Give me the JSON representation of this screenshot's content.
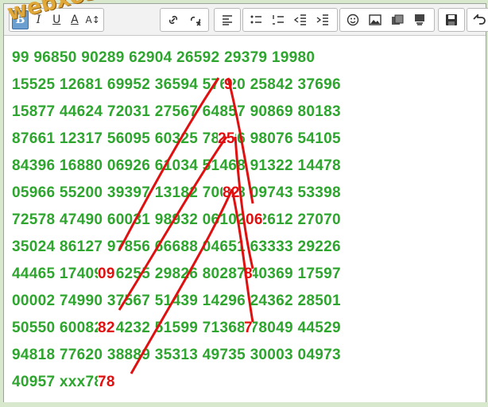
{
  "toolbar": {
    "buttons": [
      {
        "name": "bold-button",
        "glyph": "B"
      },
      {
        "name": "italic-button",
        "glyph": "I"
      },
      {
        "name": "underline-button",
        "glyph": "U"
      },
      {
        "name": "font-color-button",
        "glyph": "A"
      },
      {
        "name": "font-size-button",
        "glyph": "A↕"
      }
    ]
  },
  "watermark": "webxoso.net",
  "lottery_rows": [
    "99 96850 90289 62904 26592 29379 19980",
    "15525 12681 69952 36594 57620 25842 37696",
    "15877 44624 72031 27567 64857 90869 80183",
    "87661 12317 56095 60325 78736 98076 54105",
    "84396 16880 06926 61034 51468 91322 14478",
    "05966 55200 39397 13182 70098 09743 53398",
    "72578 47490 60031 98932 06102 12612 27070",
    "35024 86127 97856 66688 04651 63333 29226",
    "44465 17409 86255 29826 80287 40369 17597",
    "00002 74990 37567 51439 14296 24362 28501",
    "50550 60082 04232 51599 71368 78049 44529",
    "94818 77620 38889 35313 49735 30003 04973",
    "40957 xxx78"
  ],
  "highlights": [
    {
      "row": 1,
      "text": "9"
    },
    {
      "row": 3,
      "text": "25"
    },
    {
      "row": 5,
      "text": "82"
    },
    {
      "row": 6,
      "text": "06"
    },
    {
      "row": 8,
      "text": "09"
    },
    {
      "row": 8,
      "text": "8"
    },
    {
      "row": 10,
      "text": "82"
    },
    {
      "row": 10,
      "text": "7"
    },
    {
      "row": 12,
      "text": "78"
    }
  ],
  "colors": {
    "numbers": "#2ea52e",
    "highlight": "#e01010",
    "watermark": "#e0a83a"
  }
}
